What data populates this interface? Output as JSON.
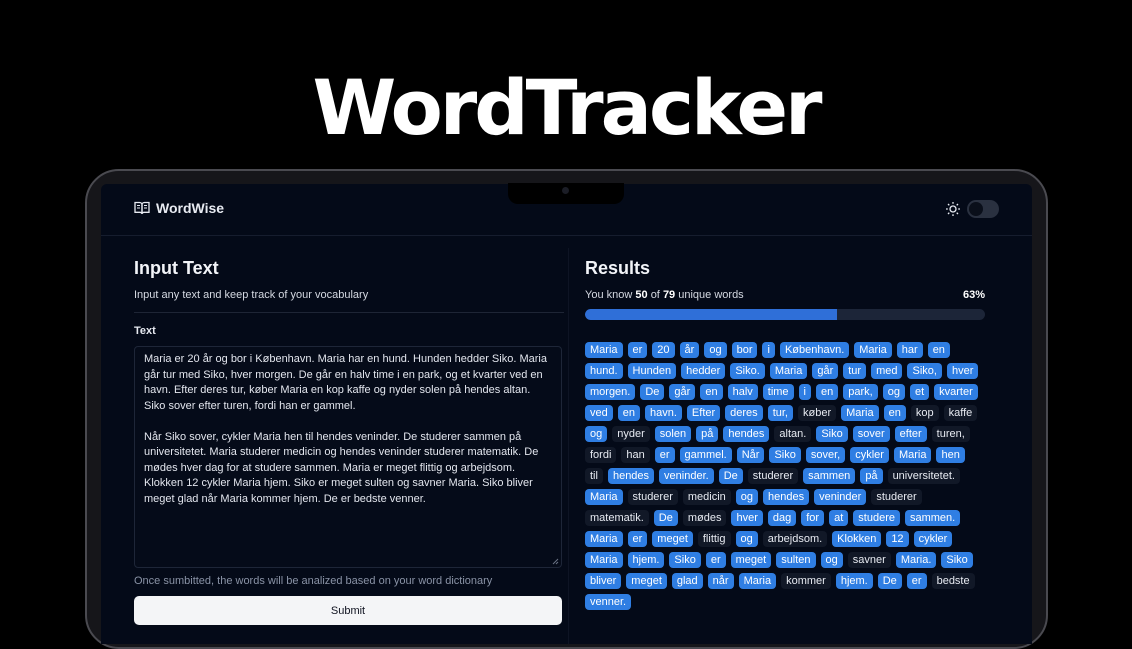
{
  "hero": {
    "title": "WordTracker"
  },
  "app": {
    "brand": "WordWise"
  },
  "input": {
    "heading": "Input Text",
    "subtitle": "Input any text and keep track of your vocabulary",
    "field_label": "Text",
    "paragraph1": "Maria er 20 år og bor i København. Maria har en hund. Hunden hedder Siko. Maria går tur med Siko, hver morgen. De går en halv time i en park, og et kvarter ved en havn. Efter deres tur, køber Maria en kop kaffe og nyder solen på hendes altan. Siko sover efter turen, fordi han er gammel.",
    "paragraph2": "Når Siko sover, cykler Maria hen til hendes veninder. De studerer sammen på universitetet. Maria studerer medicin og hendes veninder studerer matematik. De mødes hver dag for at studere sammen. Maria er meget flittig og arbejdsom. Klokken 12 cykler Maria hjem. Siko er meget sulten og savner Maria. Siko bliver meget glad når Maria kommer hjem. De er bedste venner.",
    "hint": "Once sumbitted, the words will be analized based on your word dictionary",
    "submit_label": "Submit"
  },
  "results": {
    "heading": "Results",
    "know_prefix": "You know",
    "known_count": "50",
    "of_label": "of",
    "total_count": "79",
    "suffix": "unique words",
    "percent_label": "63%",
    "percent_value": 0.63,
    "words": [
      {
        "t": "Maria",
        "k": true
      },
      {
        "t": "er",
        "k": true
      },
      {
        "t": "20",
        "k": true
      },
      {
        "t": "år",
        "k": true
      },
      {
        "t": "og",
        "k": true
      },
      {
        "t": "bor",
        "k": true
      },
      {
        "t": "i",
        "k": true
      },
      {
        "t": "København.",
        "k": true
      },
      {
        "t": "Maria",
        "k": true
      },
      {
        "t": "har",
        "k": true
      },
      {
        "t": "en",
        "k": true
      },
      {
        "t": "hund.",
        "k": true
      },
      {
        "t": "Hunden",
        "k": true
      },
      {
        "t": "hedder",
        "k": true
      },
      {
        "t": "Siko.",
        "k": true
      },
      {
        "t": "Maria",
        "k": true
      },
      {
        "t": "går",
        "k": true
      },
      {
        "t": "tur",
        "k": true
      },
      {
        "t": "med",
        "k": true
      },
      {
        "t": "Siko,",
        "k": true
      },
      {
        "t": "hver",
        "k": true
      },
      {
        "t": "morgen.",
        "k": true
      },
      {
        "t": "De",
        "k": true
      },
      {
        "t": "går",
        "k": true
      },
      {
        "t": "en",
        "k": true
      },
      {
        "t": "halv",
        "k": true
      },
      {
        "t": "time",
        "k": true
      },
      {
        "t": "i",
        "k": true
      },
      {
        "t": "en",
        "k": true
      },
      {
        "t": "park,",
        "k": true
      },
      {
        "t": "og",
        "k": true
      },
      {
        "t": "et",
        "k": true
      },
      {
        "t": "kvarter",
        "k": true
      },
      {
        "t": "ved",
        "k": true
      },
      {
        "t": "en",
        "k": true
      },
      {
        "t": "havn.",
        "k": true
      },
      {
        "t": "Efter",
        "k": true
      },
      {
        "t": "deres",
        "k": true
      },
      {
        "t": "tur,",
        "k": true
      },
      {
        "t": "køber",
        "k": false
      },
      {
        "t": "Maria",
        "k": true
      },
      {
        "t": "en",
        "k": true
      },
      {
        "t": "kop",
        "k": false
      },
      {
        "t": "kaffe",
        "k": false
      },
      {
        "t": "og",
        "k": true
      },
      {
        "t": "nyder",
        "k": false
      },
      {
        "t": "solen",
        "k": true
      },
      {
        "t": "på",
        "k": true
      },
      {
        "t": "hendes",
        "k": true
      },
      {
        "t": "altan.",
        "k": false
      },
      {
        "t": "Siko",
        "k": true
      },
      {
        "t": "sover",
        "k": true
      },
      {
        "t": "efter",
        "k": true
      },
      {
        "t": "turen,",
        "k": false
      },
      {
        "t": "fordi",
        "k": false
      },
      {
        "t": "han",
        "k": false
      },
      {
        "t": "er",
        "k": true
      },
      {
        "t": "gammel.",
        "k": true
      },
      {
        "t": "Når",
        "k": true
      },
      {
        "t": "Siko",
        "k": true
      },
      {
        "t": "sover,",
        "k": true
      },
      {
        "t": "cykler",
        "k": true
      },
      {
        "t": "Maria",
        "k": true
      },
      {
        "t": "hen",
        "k": true
      },
      {
        "t": "til",
        "k": false
      },
      {
        "t": "hendes",
        "k": true
      },
      {
        "t": "veninder.",
        "k": true
      },
      {
        "t": "De",
        "k": true
      },
      {
        "t": "studerer",
        "k": false
      },
      {
        "t": "sammen",
        "k": true
      },
      {
        "t": "på",
        "k": true
      },
      {
        "t": "universitetet.",
        "k": false
      },
      {
        "t": "Maria",
        "k": true
      },
      {
        "t": "studerer",
        "k": false
      },
      {
        "t": "medicin",
        "k": false
      },
      {
        "t": "og",
        "k": true
      },
      {
        "t": "hendes",
        "k": true
      },
      {
        "t": "veninder",
        "k": true
      },
      {
        "t": "studerer",
        "k": false
      },
      {
        "t": "matematik.",
        "k": false
      },
      {
        "t": "De",
        "k": true
      },
      {
        "t": "mødes",
        "k": false
      },
      {
        "t": "hver",
        "k": true
      },
      {
        "t": "dag",
        "k": true
      },
      {
        "t": "for",
        "k": true
      },
      {
        "t": "at",
        "k": true
      },
      {
        "t": "studere",
        "k": true
      },
      {
        "t": "sammen.",
        "k": true
      },
      {
        "t": "Maria",
        "k": true
      },
      {
        "t": "er",
        "k": true
      },
      {
        "t": "meget",
        "k": true
      },
      {
        "t": "flittig",
        "k": false
      },
      {
        "t": "og",
        "k": true
      },
      {
        "t": "arbejdsom.",
        "k": false
      },
      {
        "t": "Klokken",
        "k": true
      },
      {
        "t": "12",
        "k": true
      },
      {
        "t": "cykler",
        "k": true
      },
      {
        "t": "Maria",
        "k": true
      },
      {
        "t": "hjem.",
        "k": true
      },
      {
        "t": "Siko",
        "k": true
      },
      {
        "t": "er",
        "k": true
      },
      {
        "t": "meget",
        "k": true
      },
      {
        "t": "sulten",
        "k": true
      },
      {
        "t": "og",
        "k": true
      },
      {
        "t": "savner",
        "k": false
      },
      {
        "t": "Maria.",
        "k": true
      },
      {
        "t": "Siko",
        "k": true
      },
      {
        "t": "bliver",
        "k": true
      },
      {
        "t": "meget",
        "k": true
      },
      {
        "t": "glad",
        "k": true
      },
      {
        "t": "når",
        "k": true
      },
      {
        "t": "Maria",
        "k": true
      },
      {
        "t": "kommer",
        "k": false
      },
      {
        "t": "hjem.",
        "k": true
      },
      {
        "t": "De",
        "k": true
      },
      {
        "t": "er",
        "k": true
      },
      {
        "t": "bedste",
        "k": false
      },
      {
        "t": "venner.",
        "k": true
      }
    ]
  },
  "icons": {
    "brand": "open-book-icon",
    "theme": "sun-icon"
  },
  "colors": {
    "known": "#2f7ee3",
    "unknown": "#111827",
    "progress": "#2f6fd8",
    "background": "#040a18"
  }
}
